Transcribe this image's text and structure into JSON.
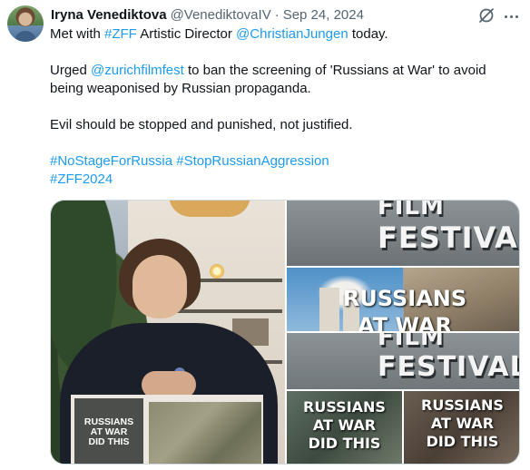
{
  "author": {
    "name": "Iryna Venediktova",
    "handle": "@VenediktovaIV",
    "separator": "·",
    "date": "Sep 24, 2024"
  },
  "tweet": {
    "line1": {
      "prefix": "Met with ",
      "tag1": "#ZFF",
      "mid": " Artistic Director ",
      "mention": "@ChristianJungen",
      "suffix": " today."
    },
    "line2": {
      "prefix": "Urged ",
      "mention": "@zurichfilmfest",
      "suffix": " to ban the screening of 'Russians at War' to avoid"
    },
    "line3": "being weaponised by Russian propaganda.",
    "line4": "Evil should be stopped and punished, not justified.",
    "hashtags_line1": " #NoStageForRussia #StopRussianAggression",
    "hashtags_line2": "#ZFF2024"
  },
  "media": {
    "poster_text": [
      "RUSSIANS",
      "AT WAR",
      "DID THIS"
    ],
    "festival_sign_top": "FILM",
    "festival_sign_main": "FESTIVAL",
    "collage_title_1": "RUSSIANS",
    "collage_title_2": "AT WAR",
    "tile_a": [
      "RUSSIANS",
      "AT WAR",
      "DID THIS"
    ],
    "tile_b": [
      "RUSSIANS",
      "AT WAR",
      "DID THIS"
    ]
  },
  "icons": {
    "grok": "grok-icon",
    "more": "more-options-icon"
  },
  "colors": {
    "link": "#1d9bf0",
    "muted": "#536471",
    "text": "#0f1419"
  }
}
